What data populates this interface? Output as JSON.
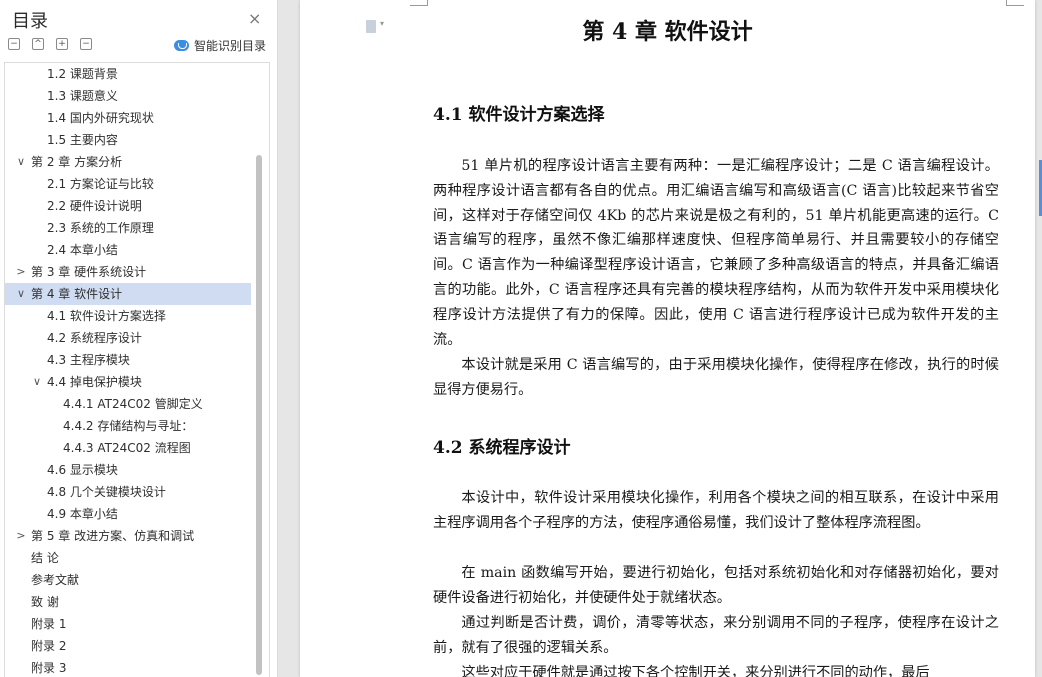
{
  "toc": {
    "title": "目录",
    "close_icon": "×",
    "smart_label": "智能识别目录",
    "toolbar": [
      "−",
      "^",
      "+",
      "−"
    ],
    "items": [
      {
        "text": "1.2  课题背景",
        "level": 2
      },
      {
        "text": "1.3  课题意义",
        "level": 2
      },
      {
        "text": "1.4  国内外研究现状",
        "level": 2
      },
      {
        "text": "1.5  主要内容",
        "level": 2
      },
      {
        "text": "第 2 章  方案分析",
        "level": 1,
        "arrow": "∨"
      },
      {
        "text": "2.1  方案论证与比较",
        "level": 2
      },
      {
        "text": "2.2  硬件设计说明",
        "level": 2
      },
      {
        "text": "2.3  系统的工作原理",
        "level": 2
      },
      {
        "text": "2.4  本章小结",
        "level": 2
      },
      {
        "text": "第 3 章  硬件系统设计",
        "level": 1,
        "arrow": ">"
      },
      {
        "text": "第 4 章  软件设计",
        "level": 1,
        "arrow": "∨",
        "active": true
      },
      {
        "text": "4.1  软件设计方案选择",
        "level": 2
      },
      {
        "text": "4.2  系统程序设计",
        "level": 2
      },
      {
        "text": "4.3  主程序模块",
        "level": 2
      },
      {
        "text": "4.4  掉电保护模块",
        "level": 2,
        "arrow": "∨"
      },
      {
        "text": "4.4.1 AT24C02 管脚定义",
        "level": 3
      },
      {
        "text": "4.4.2  存储结构与寻址：",
        "level": 3
      },
      {
        "text": "4.4.3 AT24C02 流程图",
        "level": 3
      },
      {
        "text": "4.6  显示模块",
        "level": 2
      },
      {
        "text": "4.8  几个关键模块设计",
        "level": 2
      },
      {
        "text": "4.9 本章小结",
        "level": 2
      },
      {
        "text": "第 5 章  改进方案、仿真和调试",
        "level": 1,
        "arrow": ">"
      },
      {
        "text": "结  论",
        "level": 1
      },
      {
        "text": "参考文献",
        "level": 1
      },
      {
        "text": "致  谢",
        "level": 1
      },
      {
        "text": "附录 1",
        "level": 1
      },
      {
        "text": "附录 2",
        "level": 1
      },
      {
        "text": "附录 3",
        "level": 1
      }
    ]
  },
  "document": {
    "chapter_title": "第 4 章  软件设计",
    "section1_title": "4.1  软件设计方案选择",
    "p1": "51 单片机的程序设计语言主要有两种：一是汇编程序设计；二是 C 语言编程设计。两种程序设计语言都有各自的优点。用汇编语言编写和高级语言(C 语言)比较起来节省空间，这样对于存储空间仅 4Kb 的芯片来说是极之有利的，51 单片机能更高速的运行。C 语言编写的程序，虽然不像汇编那样速度快、但程序简单易行、并且需要较小的存储空间。C 语言作为一种编译型程序设计语言，它兼顾了多种高级语言的特点，并具备汇编语言的功能。此外，C 语言程序还具有完善的模块程序结构，从而为软件开发中采用模块化程序设计方法提供了有力的保障。因此，使用 C 语言进行程序设计已成为软件开发的主流。",
    "p2": "本设计就是采用 C 语言编写的，由于采用模块化操作，使得程序在修改，执行的时候显得方便易行。",
    "section2_title": "4.2  系统程序设计",
    "p3": "本设计中，软件设计采用模块化操作，利用各个模块之间的相互联系，在设计中采用主程序调用各个子程序的方法，使程序通俗易懂，我们设计了整体程序流程图。",
    "p4": "在 main 函数编写开始，要进行初始化，包括对系统初始化和对存储器初始化，要对硬件设备进行初始化，并使硬件处于就绪状态。",
    "p5": "通过判断是否计费，调价，清零等状态，来分别调用不同的子程序，使程序在设计之前，就有了很强的逻辑关系。",
    "p6": "这些对应于硬件就是通过按下各个控制开关，来分别进行不同的动作，最后"
  }
}
